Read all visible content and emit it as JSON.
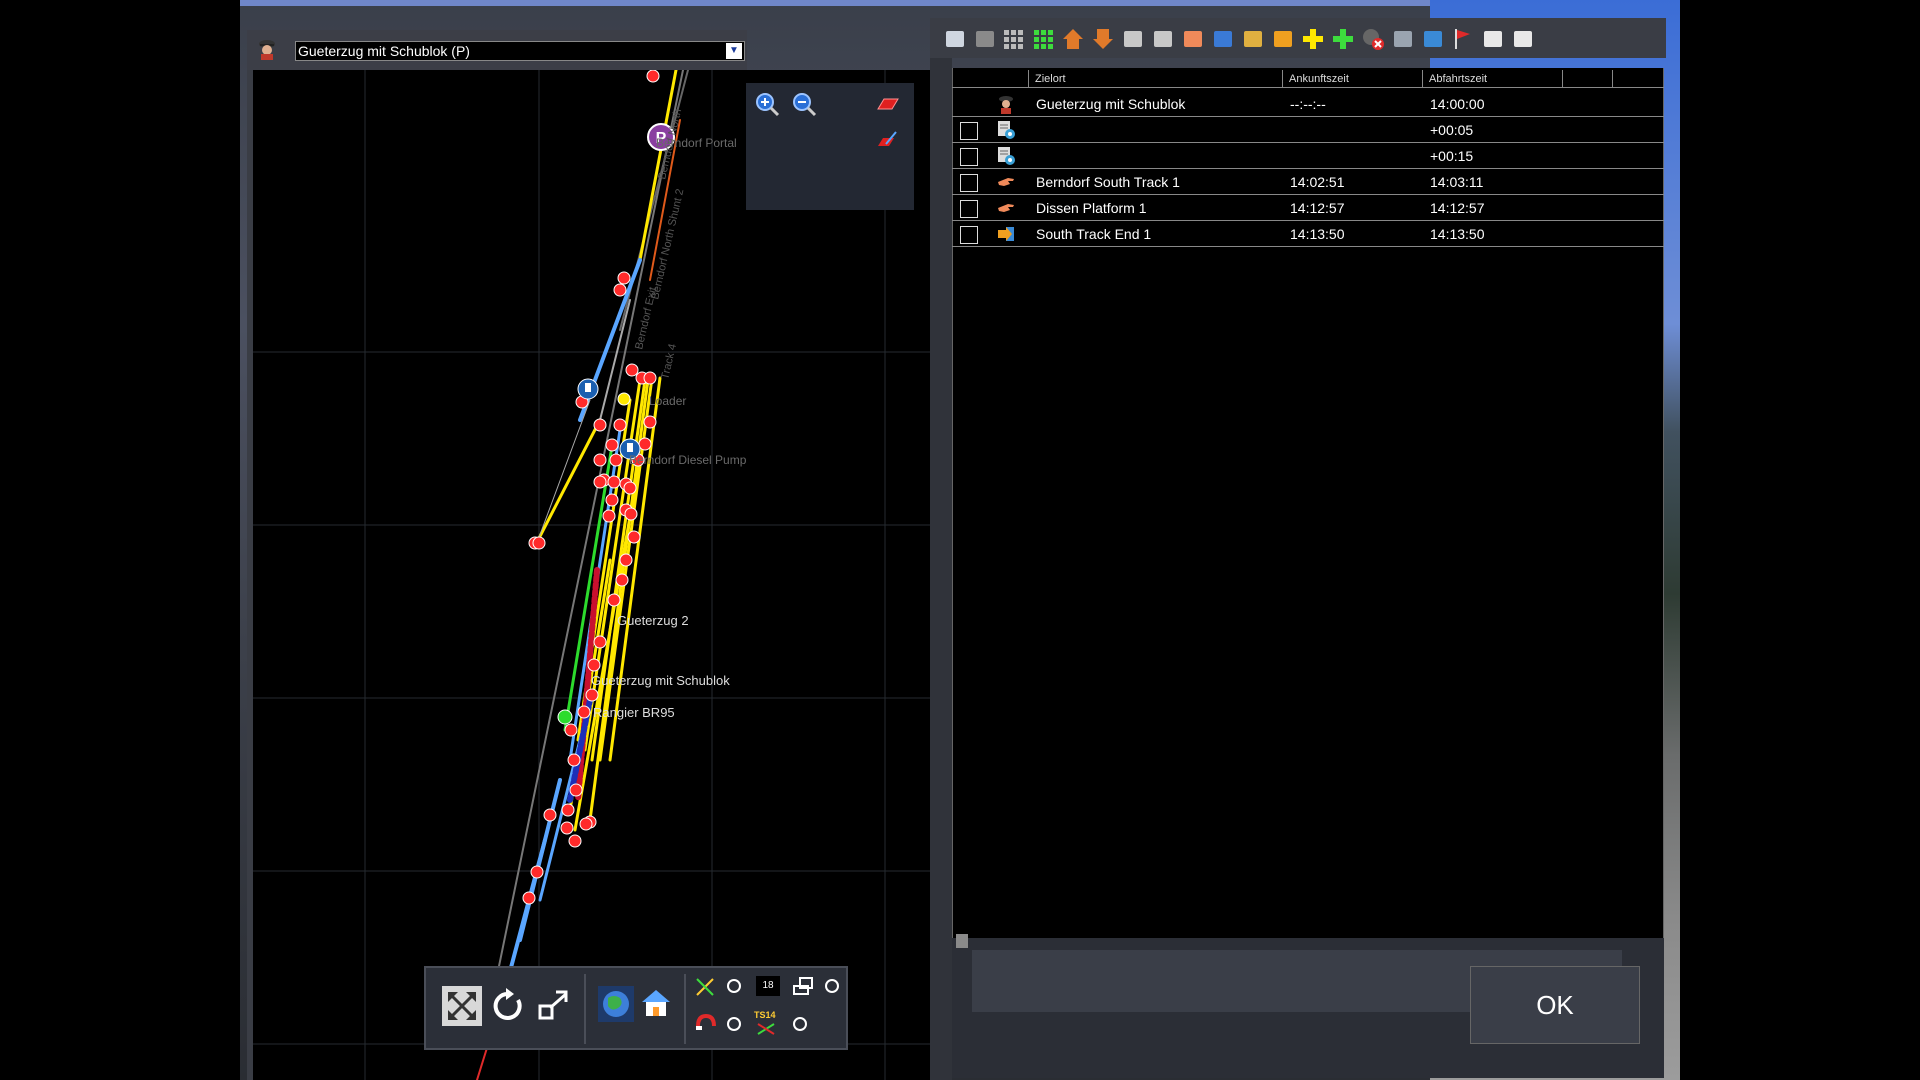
{
  "map": {
    "train_selector": {
      "value": "Gueterzug mit Schublok (P)"
    },
    "labels": [
      {
        "id": "berndorf-portal",
        "text": "Berndorf Portal"
      },
      {
        "id": "loader",
        "text": "Loader"
      },
      {
        "id": "diesel-pump",
        "text": "Berndorf Diesel Pump"
      },
      {
        "id": "gueterzug-2",
        "text": "Gueterzug 2"
      },
      {
        "id": "gueterzug-schublok",
        "text": "Gueterzug mit Schublok"
      },
      {
        "id": "rangier-br95",
        "text": "Rangier BR95"
      }
    ],
    "toolbar": {
      "time_value": "18",
      "ts_label": "TS14"
    },
    "colors": {
      "track_yellow": "#ffe800",
      "track_blue": "#5aa6ff",
      "track_green": "#2ddc2d",
      "signal_red": "#ff2a2a",
      "marker_blue": "#1a5fb0",
      "marker_purple": "#8a3fa0"
    }
  },
  "schedule": {
    "columns": [
      "Zielort",
      "Ankunftszeit",
      "Abfahrtszeit"
    ],
    "rows": [
      {
        "icon": "driver-icon",
        "has_checkbox": false,
        "destination": "Gueterzug mit Schublok",
        "arrival": "--:--:--",
        "departure": "14:00:00"
      },
      {
        "icon": "gear-instruction-icon",
        "has_checkbox": true,
        "destination": "",
        "arrival": "",
        "departure": "+00:05"
      },
      {
        "icon": "gear-instruction-icon",
        "has_checkbox": true,
        "destination": "",
        "arrival": "",
        "departure": "+00:15"
      },
      {
        "icon": "pointing-hand-icon",
        "has_checkbox": true,
        "destination": "Berndorf South Track 1",
        "arrival": "14:02:51",
        "departure": "14:03:11"
      },
      {
        "icon": "pointing-hand-icon",
        "has_checkbox": true,
        "destination": "Dissen Platform 1",
        "arrival": "14:12:57",
        "departure": "14:12:57"
      },
      {
        "icon": "track-end-icon",
        "has_checkbox": true,
        "destination": "South Track End 1",
        "arrival": "14:13:50",
        "departure": "14:13:50"
      }
    ],
    "toolbar_icons": [
      "save-icon",
      "delete-icon",
      "grid-grey-icon",
      "grid-green-icon",
      "move-up-icon",
      "move-down-icon",
      "split-left-icon",
      "split-right-icon",
      "pointing-hand-icon",
      "people-icon",
      "pickup-icon",
      "couple-icon",
      "add-yellow-icon",
      "add-green-icon",
      "remove-icon",
      "settings-icon",
      "exit-icon",
      "red-flag-icon",
      "wagon-icon",
      "roof-icon"
    ],
    "ok_label": "OK"
  }
}
